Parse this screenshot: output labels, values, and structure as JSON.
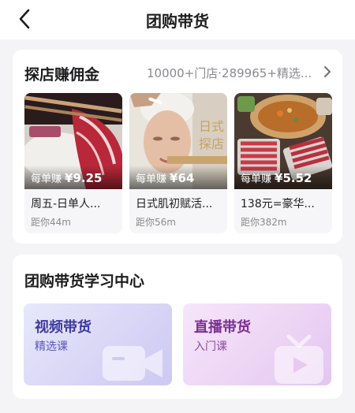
{
  "nav": {
    "title": "团购带货",
    "back_icon": "chevron-left-icon"
  },
  "shop_section": {
    "title": "探店赚佣金",
    "meta": "10000+门店·289965+精选...",
    "more_icon": "chevron-right-icon",
    "items": [
      {
        "image": "sliced-meat-photo",
        "earn_label": "每单赚",
        "earn_amount": "¥9.25",
        "name": "周五-日单人...",
        "distance": "距你44m"
      },
      {
        "image": "facial-treatment-photo",
        "earn_label": "每单赚",
        "earn_amount": "¥64",
        "name": "日式肌初赋活...",
        "distance": "距你56m"
      },
      {
        "image": "hotpot-photo",
        "earn_label": "每单赚",
        "earn_amount": "¥5.52",
        "name": "138元=豪华...",
        "distance": "距你382m"
      }
    ]
  },
  "learn_section": {
    "title": "团购带货学习中心",
    "tiles": [
      {
        "title": "视频带货",
        "subtitle": "精选课",
        "icon": "video-camera-icon",
        "accent": "#3e3a9c"
      },
      {
        "title": "直播带货",
        "subtitle": "入门课",
        "icon": "live-tv-icon",
        "accent": "#7b2f93"
      }
    ]
  },
  "colors": {
    "background": "#f4f4f6",
    "card": "#ffffff",
    "muted_text": "#8a8a8f"
  }
}
